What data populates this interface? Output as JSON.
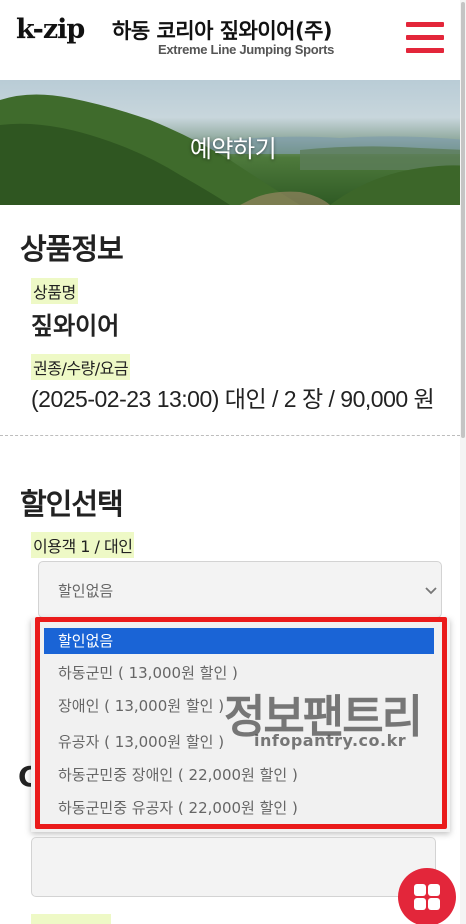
{
  "header": {
    "brand": "k-zip",
    "title": "하동 코리아 짚와이어(주)",
    "subtitle": "Extreme Line Jumping Sports"
  },
  "hero": {
    "title": "예약하기"
  },
  "product": {
    "section_title": "상품정보",
    "name_label": "상품명",
    "name": "짚와이어",
    "ticket_label": "권종/수량/요금",
    "ticket_info": "(2025-02-23 13:00) 대인 / 2 장 / 90,000 원"
  },
  "discount": {
    "section_title": "할인선택",
    "passenger_label": "이용객 1 / 대인",
    "selected": "할인없음",
    "options": [
      "할인없음",
      "하동군민 ( 13,000원 할인 )",
      "장애인 ( 13,000원 할인 )",
      "유공자 ( 13,000원 할인 )",
      "하동군민중 장애인 ( 22,000원 할인 )",
      "하동군민중 유공자 ( 22,000원 할인 )"
    ]
  },
  "watermark": {
    "main": "정보팬트리",
    "url": "infopantry.co.kr"
  },
  "colors": {
    "accent_red": "#e3263a",
    "highlight": "#eef9c6",
    "selected_option": "#1a64d6",
    "frame_red": "#ea1b1b"
  },
  "icons": {
    "menu": "hamburger-menu-icon",
    "fab": "grid-apps-icon",
    "select": "chevron-down-icon"
  }
}
